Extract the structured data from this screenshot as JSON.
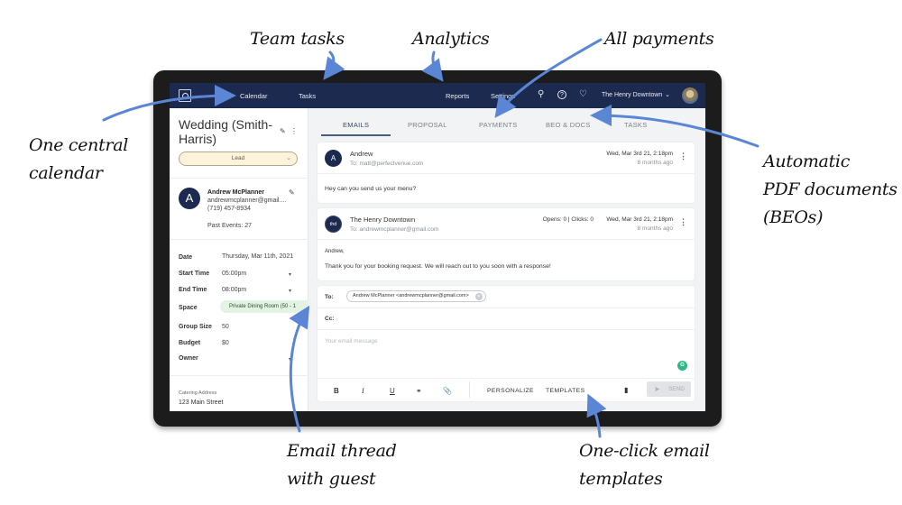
{
  "annotations": {
    "team_tasks": "Team tasks",
    "analytics": "Analytics",
    "all_payments": "All payments",
    "central_calendar": "One central\ncalendar",
    "pdf_documents": "Automatic\nPDF documents\n(BEOs)",
    "email_thread": "Email thread\nwith guest",
    "email_templates": "One-click email\ntemplates"
  },
  "nav": {
    "logo": "logo-icon",
    "items": [
      "Calendar",
      "Tasks",
      "Reports",
      "Settings"
    ],
    "icons": [
      "search-icon",
      "help-icon",
      "bell-icon"
    ],
    "venue": "The Henry Downtown",
    "accent": "#1b2a4e"
  },
  "event": {
    "title": "Wedding (Smith-Harris)",
    "status": "Lead",
    "contact": {
      "initial": "A",
      "name": "Andrew McPlanner",
      "email": "andrewmcplanner@gmail....",
      "phone": "(719) 457-8934",
      "past_events": "Past Events: 27"
    },
    "fields": [
      {
        "label": "Date",
        "value": "Thursday, Mar 11th, 2021"
      },
      {
        "label": "Start Time",
        "value": "05:00pm"
      },
      {
        "label": "End Time",
        "value": "08:00pm"
      },
      {
        "label": "Space",
        "value": "Private Dining Room (50 - 1"
      },
      {
        "label": "Group Size",
        "value": "50"
      },
      {
        "label": "Budget",
        "value": "$0"
      },
      {
        "label": "Owner",
        "value": ""
      }
    ],
    "catering_address_label": "Catering Address",
    "catering_address": "123 Main Street"
  },
  "tabs": [
    "EMAILS",
    "PROPOSAL",
    "PAYMENTS",
    "BEO & DOCS",
    "TASKS"
  ],
  "active_tab": "EMAILS",
  "emails": [
    {
      "initial": "A",
      "sender": "Andrew",
      "to": "To: matt@perfectvenue.com",
      "date": "Wed, Mar 3rd 21, 2:18pm",
      "ago": "8 months ago",
      "body": [
        "Hey can you send us your menu?"
      ]
    },
    {
      "initial": "thd",
      "sender": "The Henry Downtown",
      "to": "To: andrewmcplanner@gmail.com",
      "stats": "Opens: 0 | Clicks: 0",
      "date": "Wed, Mar 3rd 21, 2:18pm",
      "ago": "8 months ago",
      "body": [
        "Andrew,",
        "Thank you for your booking request. We will reach out to you soon with a response!"
      ]
    }
  ],
  "composer": {
    "to_label": "To:",
    "to_value": "Andrew McPlanner <andrewmcplanner@gmail.com>",
    "cc_label": "Cc:",
    "placeholder": "Your email message",
    "tools": [
      "B",
      "I",
      "U"
    ],
    "personalize": "PERSONALIZE",
    "templates": "TEMPLATES",
    "send": "SEND"
  }
}
